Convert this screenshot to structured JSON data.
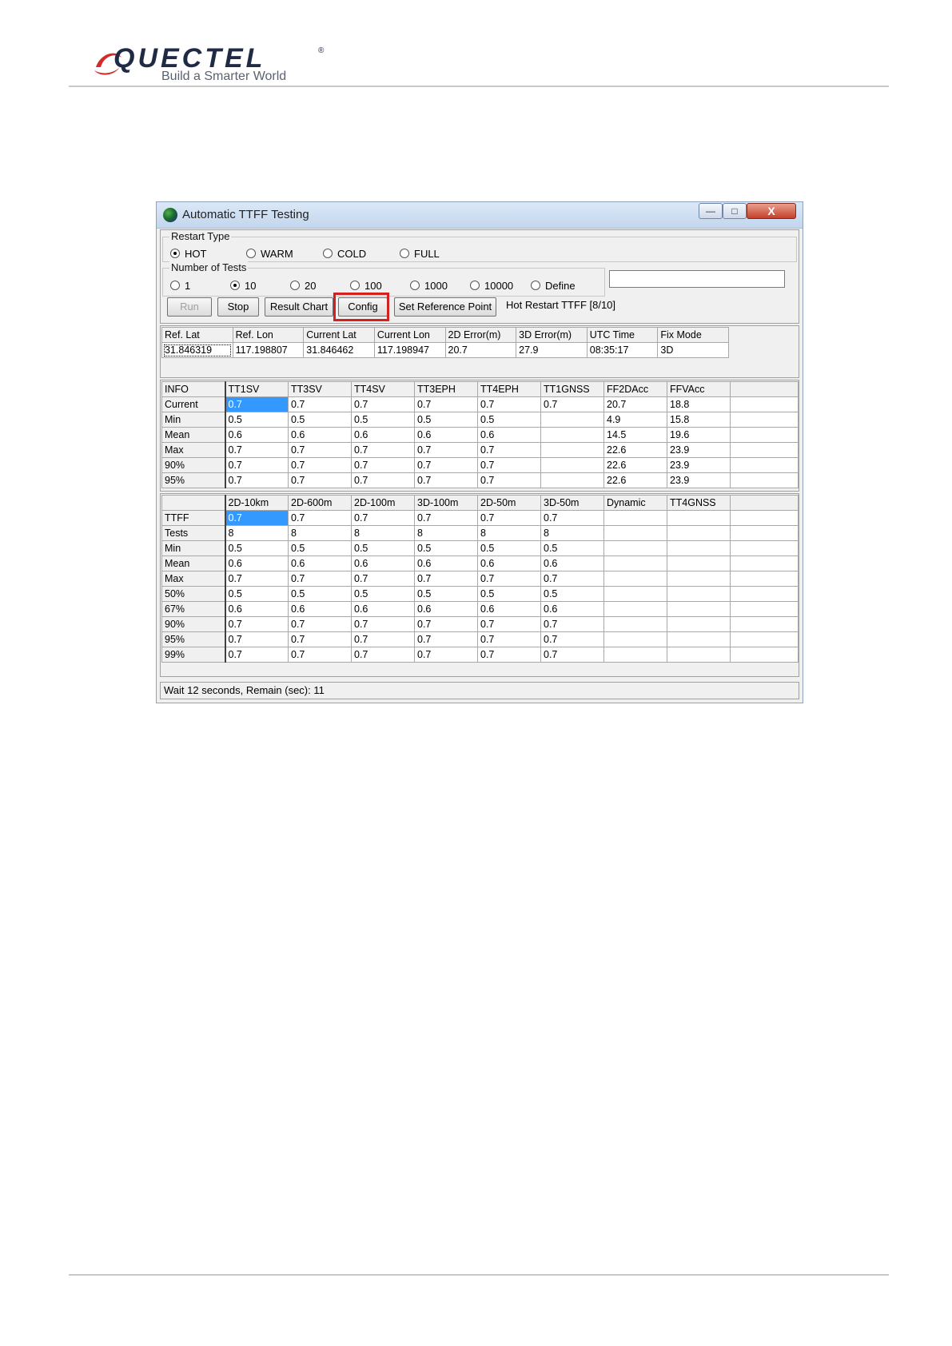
{
  "brand": {
    "name": "QUECTEL",
    "registered": "®",
    "tagline": "Build a Smarter World"
  },
  "window": {
    "title": "Automatic TTFF Testing",
    "controls": {
      "minimize": "—",
      "maximize": "□",
      "close": "X"
    }
  },
  "restart_type": {
    "legend": "Restart Type",
    "options": [
      "HOT",
      "WARM",
      "COLD",
      "FULL"
    ],
    "selected": "HOT"
  },
  "number_of_tests": {
    "legend": "Number of Tests",
    "options": [
      "1",
      "10",
      "20",
      "100",
      "1000",
      "10000",
      "Define"
    ],
    "selected": "10",
    "define_value": ""
  },
  "toolbar": {
    "run": "Run",
    "stop": "Stop",
    "result_chart": "Result Chart",
    "config": "Config",
    "set_reference_point": "Set Reference Point",
    "status": "Hot Restart TTFF [8/10]"
  },
  "position_table": {
    "columns": [
      "Ref. Lat",
      "Ref. Lon",
      "Current Lat",
      "Current Lon",
      "2D Error(m)",
      "3D Error(m)",
      "UTC Time",
      "Fix Mode"
    ],
    "row": [
      "31.846319",
      "117.198807",
      "31.846462",
      "117.198947",
      "20.7",
      "27.9",
      "08:35:17",
      "3D"
    ]
  },
  "info_table": {
    "columns": [
      "INFO",
      "TT1SV",
      "TT3SV",
      "TT4SV",
      "TT3EPH",
      "TT4EPH",
      "TT1GNSS",
      "FF2DAcc",
      "FFVAcc",
      ""
    ],
    "rows": [
      [
        "Current",
        "0.7",
        "0.7",
        "0.7",
        "0.7",
        "0.7",
        "0.7",
        "20.7",
        "18.8",
        ""
      ],
      [
        "Min",
        "0.5",
        "0.5",
        "0.5",
        "0.5",
        "0.5",
        "",
        "4.9",
        "15.8",
        ""
      ],
      [
        "Mean",
        "0.6",
        "0.6",
        "0.6",
        "0.6",
        "0.6",
        "",
        "14.5",
        "19.6",
        ""
      ],
      [
        "Max",
        "0.7",
        "0.7",
        "0.7",
        "0.7",
        "0.7",
        "",
        "22.6",
        "23.9",
        ""
      ],
      [
        "90%",
        "0.7",
        "0.7",
        "0.7",
        "0.7",
        "0.7",
        "",
        "22.6",
        "23.9",
        ""
      ],
      [
        "95%",
        "0.7",
        "0.7",
        "0.7",
        "0.7",
        "0.7",
        "",
        "22.6",
        "23.9",
        ""
      ]
    ]
  },
  "ttff_table": {
    "columns": [
      "",
      "2D-10km",
      "2D-600m",
      "2D-100m",
      "3D-100m",
      "2D-50m",
      "3D-50m",
      "Dynamic",
      "TT4GNSS",
      ""
    ],
    "rows": [
      [
        "TTFF",
        "0.7",
        "0.7",
        "0.7",
        "0.7",
        "0.7",
        "0.7",
        "",
        "",
        ""
      ],
      [
        "Tests",
        "8",
        "8",
        "8",
        "8",
        "8",
        "8",
        "",
        "",
        ""
      ],
      [
        "Min",
        "0.5",
        "0.5",
        "0.5",
        "0.5",
        "0.5",
        "0.5",
        "",
        "",
        ""
      ],
      [
        "Mean",
        "0.6",
        "0.6",
        "0.6",
        "0.6",
        "0.6",
        "0.6",
        "",
        "",
        ""
      ],
      [
        "Max",
        "0.7",
        "0.7",
        "0.7",
        "0.7",
        "0.7",
        "0.7",
        "",
        "",
        ""
      ],
      [
        "50%",
        "0.5",
        "0.5",
        "0.5",
        "0.5",
        "0.5",
        "0.5",
        "",
        "",
        ""
      ],
      [
        "67%",
        "0.6",
        "0.6",
        "0.6",
        "0.6",
        "0.6",
        "0.6",
        "",
        "",
        ""
      ],
      [
        "90%",
        "0.7",
        "0.7",
        "0.7",
        "0.7",
        "0.7",
        "0.7",
        "",
        "",
        ""
      ],
      [
        "95%",
        "0.7",
        "0.7",
        "0.7",
        "0.7",
        "0.7",
        "0.7",
        "",
        "",
        ""
      ],
      [
        "99%",
        "0.7",
        "0.7",
        "0.7",
        "0.7",
        "0.7",
        "0.7",
        "",
        "",
        ""
      ]
    ]
  },
  "statusbar": "Wait 12 seconds, Remain (sec): 11",
  "colors": {
    "selection": "#3399ff",
    "highlight_box": "#d32020",
    "brand_red": "#d42a2a"
  }
}
